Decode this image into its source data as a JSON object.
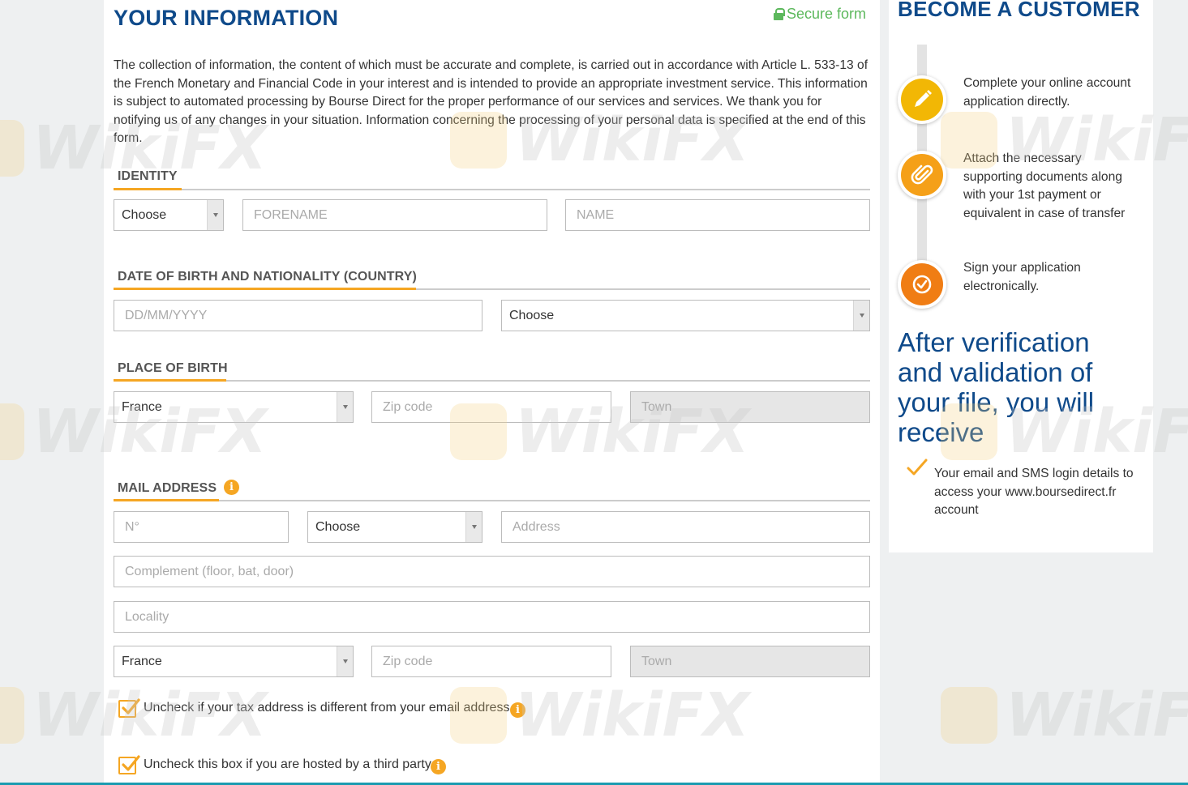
{
  "form": {
    "title": "YOUR INFORMATION",
    "secure_label": "Secure form",
    "intro": "The collection of information, the content of which must be accurate and complete, is carried out in accordance with Article L. 533-13 of the French Monetary and Financial Code in your interest and is intended to provide an appropriate investment service. This information is subject to automated processing by Bourse Direct for the proper performance of our services and services. We thank you for notifying us of any changes in your situation. Information concerning the processing of your personal data is specified at the end of this form.",
    "identity": {
      "heading": "IDENTITY",
      "civility_value": "Choose",
      "forename_placeholder": "FORENAME",
      "name_placeholder": "NAME"
    },
    "birth": {
      "heading": "DATE OF BIRTH AND NATIONALITY (COUNTRY)",
      "date_placeholder": "DD/MM/YYYY",
      "nationality_value": "Choose"
    },
    "place": {
      "heading": "PLACE OF BIRTH",
      "country_value": "France",
      "zip_placeholder": "Zip code",
      "town_placeholder": "Town"
    },
    "mail": {
      "heading": "MAIL ADDRESS",
      "info_glyph": "i",
      "number_placeholder": "N°",
      "street_type_value": "Choose",
      "address_placeholder": "Address",
      "complement_placeholder": "Complement (floor, bat, door)",
      "locality_placeholder": "Locality",
      "country_value": "France",
      "zip_placeholder": "Zip code",
      "town_placeholder": "Town"
    },
    "checkboxes": [
      {
        "label": "Uncheck if your tax address is different from your email address",
        "checked": true
      },
      {
        "label": "Uncheck this box if you are hosted by a third party",
        "checked": true
      }
    ]
  },
  "sidebar": {
    "title": "BECOME A CUSTOMER",
    "steps": [
      {
        "icon": "pencil-icon",
        "color": "#f2b705",
        "text": "Complete your online account application directly."
      },
      {
        "icon": "paperclip-icon",
        "color": "#f5a018",
        "text": "Attach the necessary supporting documents along with your 1st payment or equivalent in case of transfer"
      },
      {
        "icon": "check-circle-icon",
        "color": "#f07d14",
        "text": "Sign your application electronically."
      }
    ],
    "after_heading": "After verification and validation of your file, you will receive",
    "receive_item": "Your email and SMS login details to access your www.boursedirect.fr account"
  },
  "watermark": {
    "text": "WikiFX"
  },
  "colors": {
    "brand_blue": "#0f4a8a",
    "accent_orange": "#f5a623",
    "secure_green": "#5cb85c"
  }
}
